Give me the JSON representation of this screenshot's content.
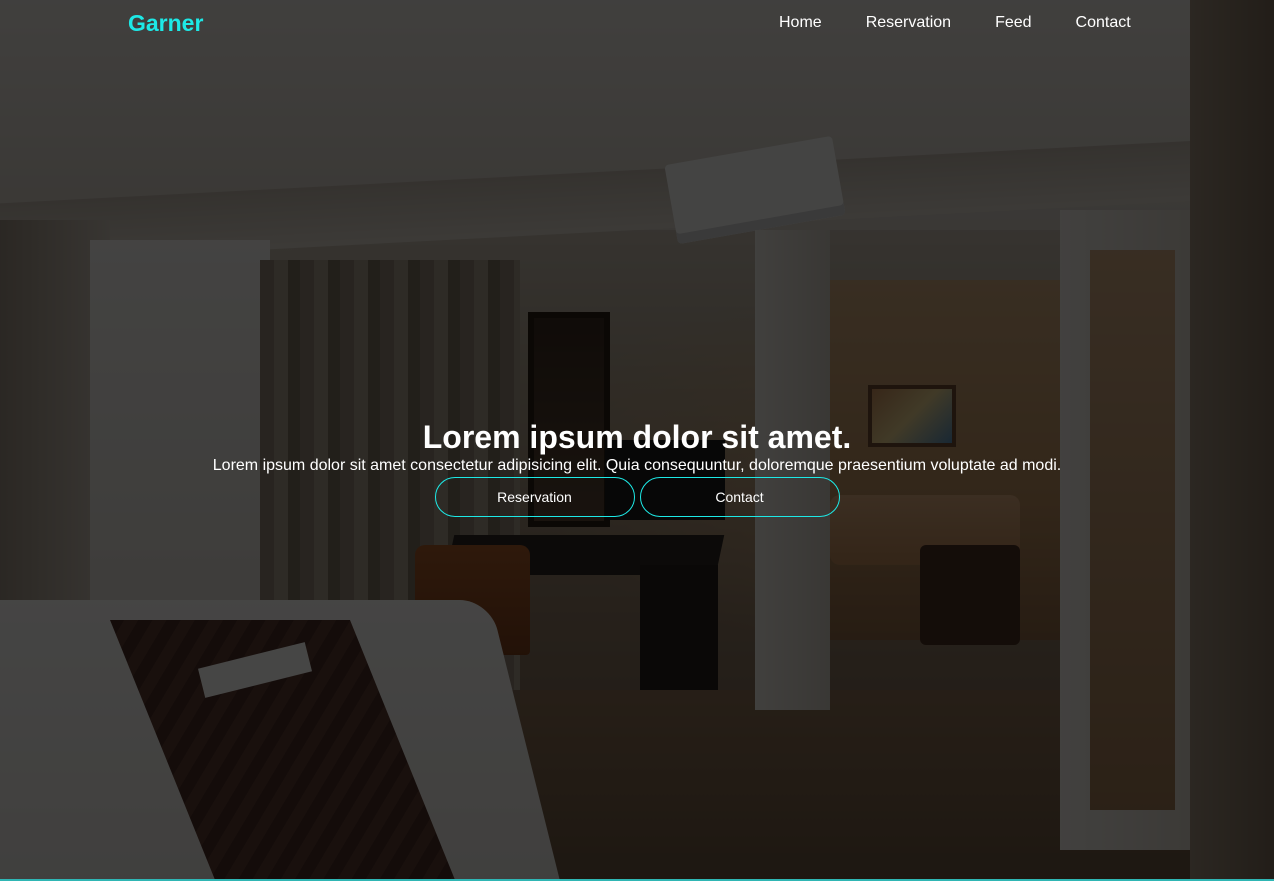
{
  "brand": {
    "name": "Garner",
    "color": "#1de9e6"
  },
  "nav": {
    "items": [
      {
        "label": "Home"
      },
      {
        "label": "Reservation"
      },
      {
        "label": "Feed"
      },
      {
        "label": "Contact"
      }
    ]
  },
  "hero": {
    "title": "Lorem ipsum dolor sit amet.",
    "subtitle": "Lorem ipsum dolor sit amet consectetur adipisicing elit. Quia consequuntur, doloremque praesentium voluptate ad modi.",
    "buttons": [
      {
        "label": "Reservation"
      },
      {
        "label": "Contact"
      }
    ],
    "accent_color": "#1de9e6",
    "background_image": "hotel-room-photo"
  }
}
